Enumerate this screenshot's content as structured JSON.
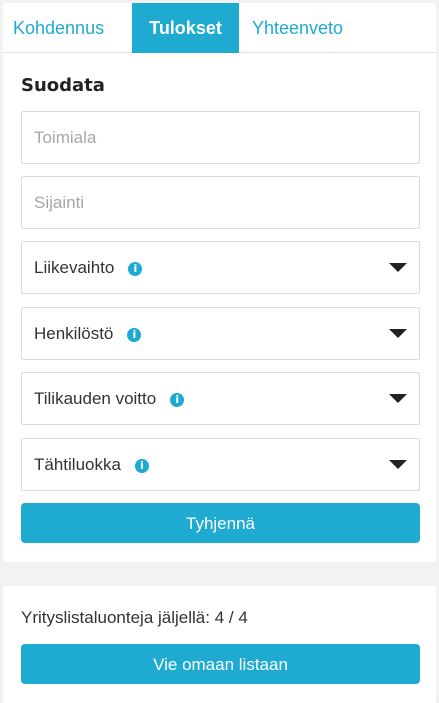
{
  "tabs": [
    {
      "label": "Kohdennus",
      "active": false
    },
    {
      "label": "Tulokset",
      "active": true
    },
    {
      "label": "Yhteenveto",
      "active": false
    }
  ],
  "filter": {
    "title": "Suodata",
    "industry_placeholder": "Toimiala",
    "location_placeholder": "Sijainti",
    "selects": [
      {
        "label": "Liikevaihto",
        "icon": "info-icon"
      },
      {
        "label": "Henkilöstö",
        "icon": "info-icon"
      },
      {
        "label": "Tilikauden voitto",
        "icon": "info-icon"
      },
      {
        "label": "Tähtiluokka",
        "icon": "info-icon"
      }
    ],
    "clear_label": "Tyhjennä"
  },
  "lists": {
    "remaining_text": "Yrityslistaluonteja jäljellä: 4 / 4",
    "export_label": "Vie omaan listaan"
  },
  "colors": {
    "accent": "#1eaad1",
    "background": "#f2f2f2"
  }
}
